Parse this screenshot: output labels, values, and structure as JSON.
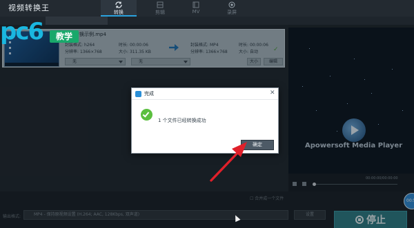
{
  "app": {
    "title": "视频转换王"
  },
  "nav": {
    "tabs": [
      {
        "label": "转换",
        "icon": "refresh-icon",
        "active": true
      },
      {
        "label": "剪辑",
        "icon": "film-icon",
        "active": false
      },
      {
        "label": "MV",
        "icon": "music-icon",
        "active": false
      },
      {
        "label": "录屏",
        "icon": "record-icon",
        "active": false
      }
    ]
  },
  "watermark": {
    "logo": "pc6",
    "badge": "教学"
  },
  "file": {
    "name": "视频转换示例.mp4",
    "source": {
      "format_label": "封装格式:",
      "format_value": "h264",
      "resolution_label": "分辨率:",
      "resolution_value": "1366×768",
      "duration_label": "时长:",
      "duration_value": "00:00:06",
      "size_label": "大小:",
      "size_value": "311.35 KB"
    },
    "target": {
      "format_label": "封装格式:",
      "format_value": "MP4",
      "resolution_label": "分辨率:",
      "resolution_value": "1366×768",
      "duration_label": "时长:",
      "duration_value": "00:00:06",
      "size_label": "大小:",
      "size_value": "自动"
    },
    "subtitle_select": "无",
    "audio_select": "无",
    "size_button": "大小",
    "edit_button": "编辑"
  },
  "dialog": {
    "title": "完成",
    "message": "1 个文件已经转换成功",
    "ok_label": "确定"
  },
  "player": {
    "name": "Apowersoft Media Player",
    "time": "00:00:00/00:00:00"
  },
  "bottom": {
    "merge_label": "合并成一个文件",
    "output_format_label": "输出格式:",
    "output_format_value": "MP4 - 保持原视频设置 (H.264; AAC, 128Kbps, 双声道)",
    "output_button": "设置",
    "stop_label": "停止",
    "bubble_text": "00:5"
  },
  "colors": {
    "accent": "#2aa3e0",
    "success": "#5bbf3f",
    "stop_button": "#2d7b85",
    "arrow_red": "#e0202a"
  }
}
